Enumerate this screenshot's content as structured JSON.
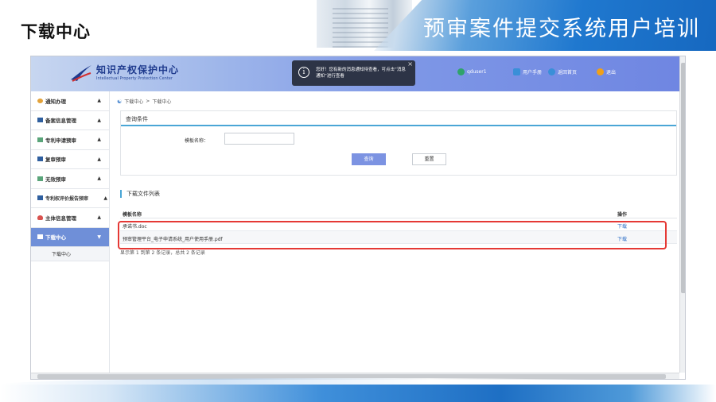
{
  "slide": {
    "title_left": "下载中心",
    "title_right": "预审案件提交系统用户培训"
  },
  "app": {
    "logo_cn": "知识产权保护中心",
    "logo_en": "Intellectual Property Protection Center",
    "notice": {
      "text": "您好！您有新的消息通知待查看，可点击“消息通知”进行查看",
      "close": "×"
    },
    "header": {
      "user": "qduser1",
      "manual": "用户手册",
      "home": "返回首页",
      "logout": "退出"
    }
  },
  "sidebar": {
    "items": [
      {
        "label": "通知办理",
        "chev": "▲"
      },
      {
        "label": "备案信息管理",
        "chev": "▲"
      },
      {
        "label": "专利申请预审",
        "chev": "▲"
      },
      {
        "label": "复审预审",
        "chev": "▲"
      },
      {
        "label": "无效预审",
        "chev": "▲"
      },
      {
        "label": "专利权评价报告预审",
        "chev": "▲"
      },
      {
        "label": "主体信息管理",
        "chev": "▲"
      },
      {
        "label": "下载中心",
        "chev": "▼"
      }
    ],
    "sub_item": "下载中心"
  },
  "breadcrumb": {
    "items": [
      "下载中心",
      ">",
      "下载中心"
    ]
  },
  "query": {
    "title": "查询条件",
    "label": "模板名称：",
    "input_value": "",
    "search_btn": "查询",
    "reset_btn": "重置"
  },
  "list": {
    "title": "下载文件列表",
    "columns": [
      "模板名称",
      "操作"
    ],
    "rows": [
      {
        "name": "承诺书.doc",
        "action": "下载"
      },
      {
        "name": "预审管理平台_电子申请系统_用户使用手册.pdf",
        "action": "下载"
      }
    ],
    "pager": "显示第 1 到第 2 条记录，总共 2 条记录"
  },
  "colors": {
    "header_blue": "#7d96e6",
    "active_nav": "#6f8fd8",
    "accent_rule": "#4aa6d6",
    "highlight_red": "#e53935"
  }
}
